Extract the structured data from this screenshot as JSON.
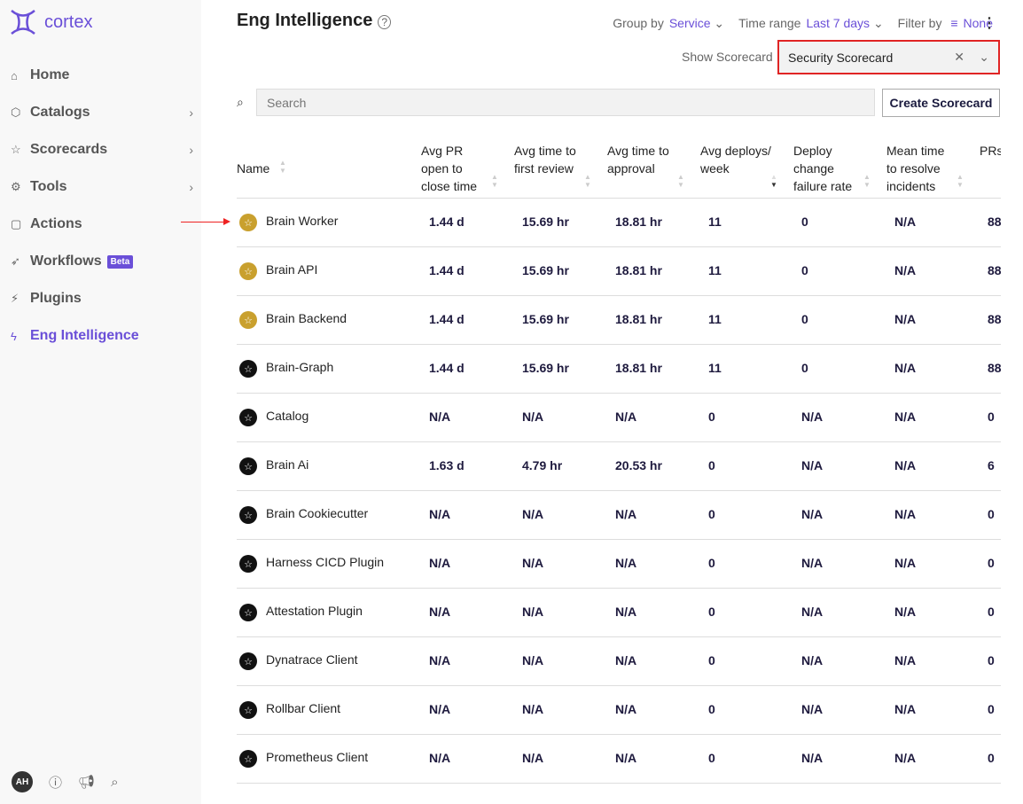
{
  "brand": {
    "name": "cortex",
    "color": "#6a4fd8"
  },
  "sidebar": {
    "items": [
      {
        "label": "Home",
        "icon": "home-icon",
        "chevron": false
      },
      {
        "label": "Catalogs",
        "icon": "cube-icon",
        "chevron": true
      },
      {
        "label": "Scorecards",
        "icon": "star-icon",
        "chevron": true
      },
      {
        "label": "Tools",
        "icon": "gear-icon",
        "chevron": true
      },
      {
        "label": "Actions",
        "icon": "actions-icon",
        "chevron": false
      },
      {
        "label": "Workflows",
        "icon": "rocket-icon",
        "chevron": false,
        "badge": "Beta"
      },
      {
        "label": "Plugins",
        "icon": "plug-icon",
        "chevron": false
      },
      {
        "label": "Eng Intelligence",
        "icon": "bolt-icon",
        "chevron": false,
        "active": true
      }
    ],
    "user_initials": "AH"
  },
  "header": {
    "title": "Eng Intelligence",
    "group_by_label": "Group by",
    "group_by_value": "Service",
    "time_range_label": "Time range",
    "time_range_value": "Last 7 days",
    "filter_label": "Filter by",
    "filter_value": "None",
    "show_scorecard_label": "Show Scorecard",
    "scorecard_value": "Security Scorecard"
  },
  "search": {
    "placeholder": "Search"
  },
  "create_button": "Create Scorecard",
  "table": {
    "columns": [
      "Name",
      "Avg PR open to close time",
      "Avg time to first review",
      "Avg time to approval",
      "Avg deploys/ week",
      "Deploy change failure rate",
      "Mean time to resolve incidents",
      "PRs ope"
    ],
    "rows": [
      {
        "name": "Brain Worker",
        "level": "gold",
        "values": [
          "1.44 d",
          "15.69 hr",
          "18.81 hr",
          "11",
          "0",
          "N/A",
          "88"
        ]
      },
      {
        "name": "Brain API",
        "level": "gold",
        "values": [
          "1.44 d",
          "15.69 hr",
          "18.81 hr",
          "11",
          "0",
          "N/A",
          "88"
        ]
      },
      {
        "name": "Brain Backend",
        "level": "gold",
        "values": [
          "1.44 d",
          "15.69 hr",
          "18.81 hr",
          "11",
          "0",
          "N/A",
          "88"
        ]
      },
      {
        "name": "Brain-Graph",
        "level": "none",
        "values": [
          "1.44 d",
          "15.69 hr",
          "18.81 hr",
          "11",
          "0",
          "N/A",
          "88"
        ]
      },
      {
        "name": "Catalog",
        "level": "none",
        "values": [
          "N/A",
          "N/A",
          "N/A",
          "0",
          "N/A",
          "N/A",
          "0"
        ]
      },
      {
        "name": "Brain Ai",
        "level": "none",
        "values": [
          "1.63 d",
          "4.79 hr",
          "20.53 hr",
          "0",
          "N/A",
          "N/A",
          "6"
        ]
      },
      {
        "name": "Brain Cookiecutter",
        "level": "none",
        "values": [
          "N/A",
          "N/A",
          "N/A",
          "0",
          "N/A",
          "N/A",
          "0"
        ]
      },
      {
        "name": "Harness CICD Plugin",
        "level": "none",
        "values": [
          "N/A",
          "N/A",
          "N/A",
          "0",
          "N/A",
          "N/A",
          "0"
        ]
      },
      {
        "name": "Attestation Plugin",
        "level": "none",
        "values": [
          "N/A",
          "N/A",
          "N/A",
          "0",
          "N/A",
          "N/A",
          "0"
        ]
      },
      {
        "name": "Dynatrace Client",
        "level": "none",
        "values": [
          "N/A",
          "N/A",
          "N/A",
          "0",
          "N/A",
          "N/A",
          "0"
        ]
      },
      {
        "name": "Rollbar Client",
        "level": "none",
        "values": [
          "N/A",
          "N/A",
          "N/A",
          "0",
          "N/A",
          "N/A",
          "0"
        ]
      },
      {
        "name": "Prometheus Client",
        "level": "none",
        "values": [
          "N/A",
          "N/A",
          "N/A",
          "0",
          "N/A",
          "N/A",
          "0"
        ]
      }
    ],
    "sorted_column": "Avg deploys/ week",
    "level_colors": {
      "gold": "#c9a02e",
      "none": "#111111"
    }
  }
}
